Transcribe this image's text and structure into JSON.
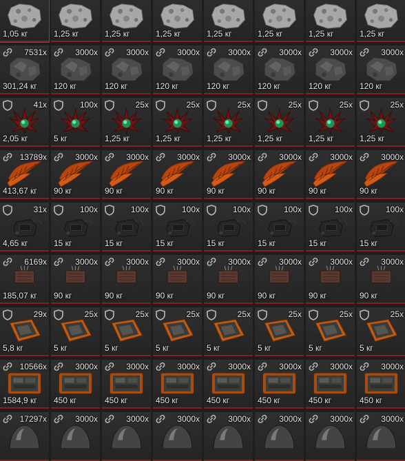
{
  "icons": {
    "shield": "shield-icon",
    "link": "link-icon"
  },
  "colors": {
    "cell_border": "#8a1e1e",
    "text": "#e6e6e6",
    "background": "#1e1e1e"
  },
  "rows": [
    {
      "item": "ore-rock",
      "icon": "",
      "cells": [
        {
          "qty": "",
          "weight": "1,05 кг"
        },
        {
          "qty": "",
          "weight": "1,25 кг"
        },
        {
          "qty": "",
          "weight": "1,25 кг"
        },
        {
          "qty": "",
          "weight": "1,25 кг"
        },
        {
          "qty": "",
          "weight": "1,25 кг"
        },
        {
          "qty": "",
          "weight": "1,25 кг"
        },
        {
          "qty": "",
          "weight": "1,25 кг"
        },
        {
          "qty": "",
          "weight": "1,25 кг"
        }
      ]
    },
    {
      "item": "scrap-rock",
      "icon": "link",
      "cells": [
        {
          "qty": "7531x",
          "weight": "301,24 кг"
        },
        {
          "qty": "3000x",
          "weight": "120 кг"
        },
        {
          "qty": "3000x",
          "weight": "120 кг"
        },
        {
          "qty": "3000x",
          "weight": "120 кг"
        },
        {
          "qty": "3000x",
          "weight": "120 кг"
        },
        {
          "qty": "3000x",
          "weight": "120 кг"
        },
        {
          "qty": "3000x",
          "weight": "120 кг"
        },
        {
          "qty": "3000x",
          "weight": "120 кг"
        }
      ]
    },
    {
      "item": "crystal-plant",
      "icon": "shield",
      "cells": [
        {
          "qty": "41x",
          "weight": "2,05 кг"
        },
        {
          "qty": "100x",
          "weight": "5 кг"
        },
        {
          "qty": "25x",
          "weight": "1,25 кг"
        },
        {
          "qty": "25x",
          "weight": "1,25 кг"
        },
        {
          "qty": "25x",
          "weight": "1,25 кг"
        },
        {
          "qty": "25x",
          "weight": "1,25 кг"
        },
        {
          "qty": "25x",
          "weight": "1,25 кг"
        },
        {
          "qty": "25x",
          "weight": "1,25 кг"
        }
      ]
    },
    {
      "item": "fern-leaf",
      "icon": "link",
      "cells": [
        {
          "qty": "13789x",
          "weight": "413,67 кг"
        },
        {
          "qty": "3000x",
          "weight": "90 кг"
        },
        {
          "qty": "3000x",
          "weight": "90 кг"
        },
        {
          "qty": "3000x",
          "weight": "90 кг"
        },
        {
          "qty": "3000x",
          "weight": "90 кг"
        },
        {
          "qty": "3000x",
          "weight": "90 кг"
        },
        {
          "qty": "3000x",
          "weight": "90 кг"
        },
        {
          "qty": "3000x",
          "weight": "90 кг"
        }
      ]
    },
    {
      "item": "dark-device",
      "icon": "shield",
      "cells": [
        {
          "qty": "31x",
          "weight": "4,65 кг"
        },
        {
          "qty": "100x",
          "weight": "15 кг"
        },
        {
          "qty": "100x",
          "weight": "15 кг"
        },
        {
          "qty": "100x",
          "weight": "15 кг"
        },
        {
          "qty": "100x",
          "weight": "15 кг"
        },
        {
          "qty": "100x",
          "weight": "15 кг"
        },
        {
          "qty": "100x",
          "weight": "15 кг"
        },
        {
          "qty": "100x",
          "weight": "15 кг"
        }
      ]
    },
    {
      "item": "wire-module",
      "icon": "link",
      "cells": [
        {
          "qty": "6169x",
          "weight": "185,07 кг"
        },
        {
          "qty": "3000x",
          "weight": "90 кг"
        },
        {
          "qty": "3000x",
          "weight": "90 кг"
        },
        {
          "qty": "3000x",
          "weight": "90 кг"
        },
        {
          "qty": "3000x",
          "weight": "90 кг"
        },
        {
          "qty": "3000x",
          "weight": "90 кг"
        },
        {
          "qty": "3000x",
          "weight": "90 кг"
        },
        {
          "qty": "3000x",
          "weight": "90 кг"
        }
      ]
    },
    {
      "item": "orange-tablet",
      "icon": "shield",
      "cells": [
        {
          "qty": "29x",
          "weight": "5,8 кг"
        },
        {
          "qty": "25x",
          "weight": "5 кг"
        },
        {
          "qty": "25x",
          "weight": "5 кг"
        },
        {
          "qty": "25x",
          "weight": "5 кг"
        },
        {
          "qty": "25x",
          "weight": "5 кг"
        },
        {
          "qty": "25x",
          "weight": "5 кг"
        },
        {
          "qty": "25x",
          "weight": "5 кг"
        },
        {
          "qty": "25x",
          "weight": "5 кг"
        }
      ]
    },
    {
      "item": "orange-panel",
      "icon": "link",
      "cells": [
        {
          "qty": "10566x",
          "weight": "1584,9 кг"
        },
        {
          "qty": "3000x",
          "weight": "450 кг"
        },
        {
          "qty": "3000x",
          "weight": "450 кг"
        },
        {
          "qty": "3000x",
          "weight": "450 кг"
        },
        {
          "qty": "3000x",
          "weight": "450 кг"
        },
        {
          "qty": "3000x",
          "weight": "450 кг"
        },
        {
          "qty": "3000x",
          "weight": "450 кг"
        },
        {
          "qty": "3000x",
          "weight": "450 кг"
        }
      ]
    },
    {
      "item": "metal-dome",
      "icon": "link",
      "cells": [
        {
          "qty": "17297x",
          "weight": ""
        },
        {
          "qty": "3000x",
          "weight": ""
        },
        {
          "qty": "3000x",
          "weight": ""
        },
        {
          "qty": "3000x",
          "weight": ""
        },
        {
          "qty": "3000x",
          "weight": ""
        },
        {
          "qty": "3000x",
          "weight": ""
        },
        {
          "qty": "3000x",
          "weight": ""
        },
        {
          "qty": "3000x",
          "weight": ""
        }
      ]
    }
  ]
}
